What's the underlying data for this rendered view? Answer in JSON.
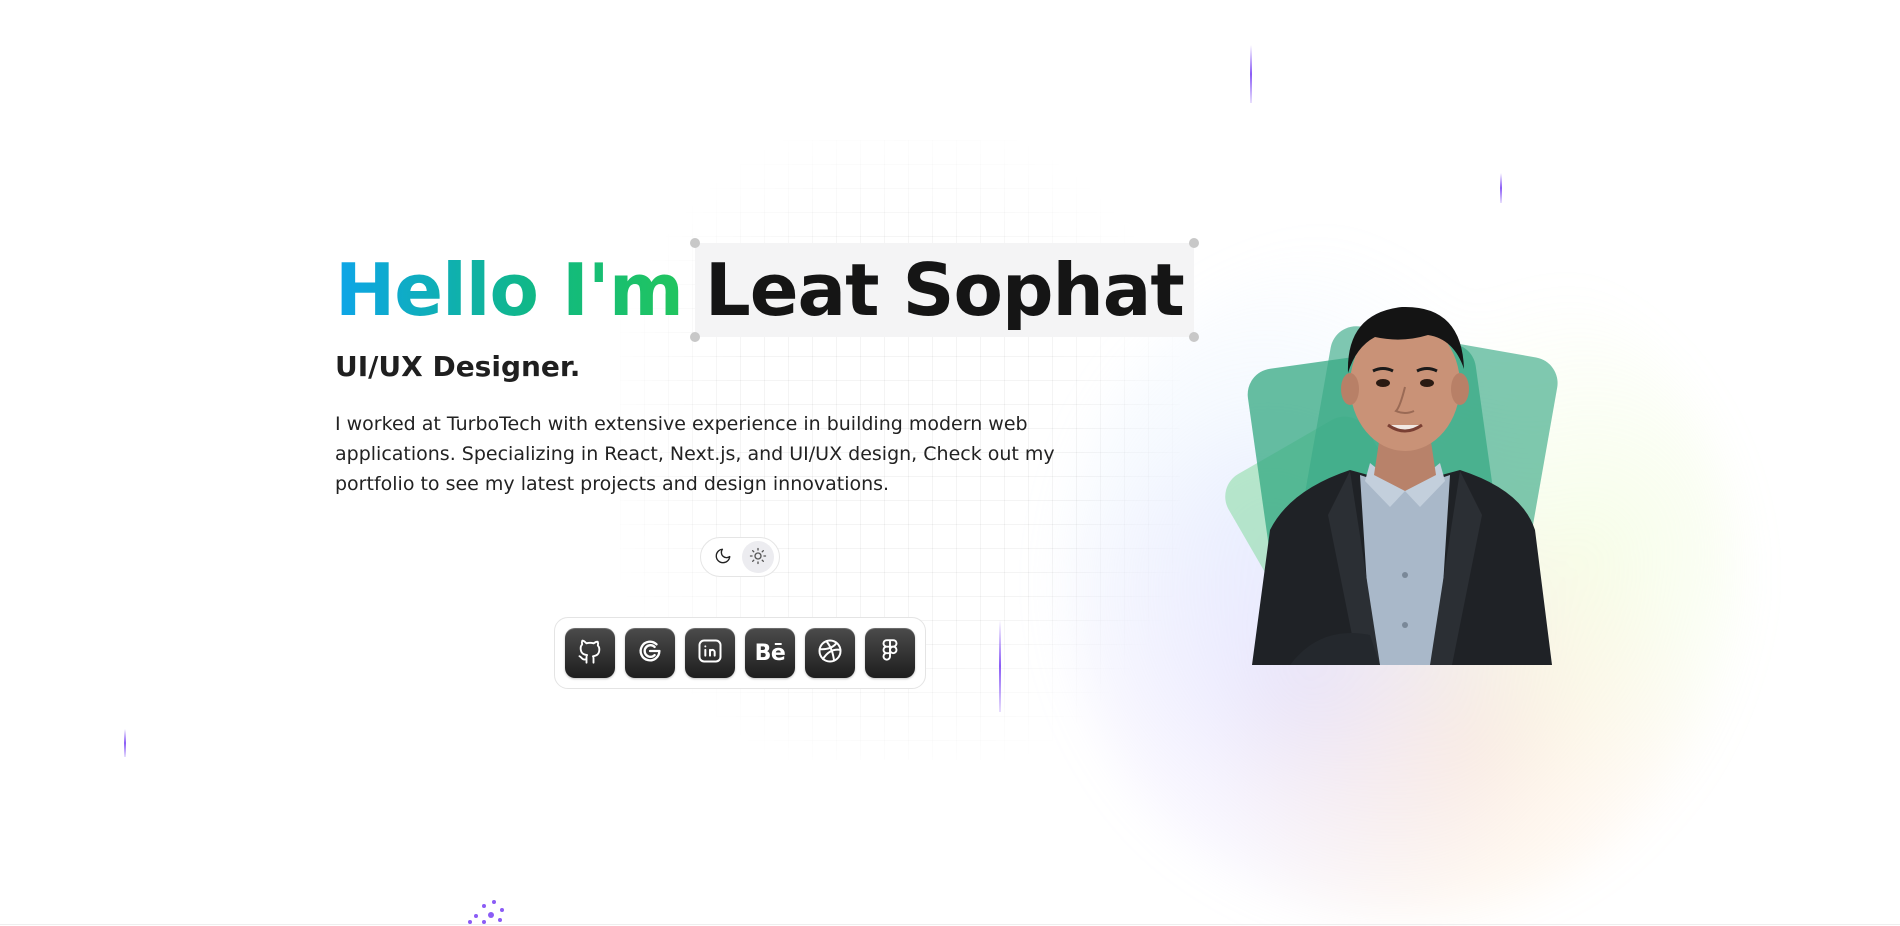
{
  "hero": {
    "greeting": "Hello I'm",
    "name": "Leat Sophat",
    "role": "UI/UX Designer.",
    "bio": "I worked at TurboTech with extensive experience in building modern web applications. Specializing in React, Next.js, and UI/UX design, Check out my portfolio to see my latest projects and design innovations."
  },
  "theme_toggle": {
    "options": [
      {
        "icon": "moon-icon",
        "active": false
      },
      {
        "icon": "sun-icon",
        "active": true
      }
    ]
  },
  "social_links": [
    {
      "icon": "github-icon"
    },
    {
      "icon": "google-icon"
    },
    {
      "icon": "linkedin-icon"
    },
    {
      "icon": "behance-icon",
      "label": "Bē"
    },
    {
      "icon": "dribbble-icon"
    },
    {
      "icon": "figma-icon"
    }
  ],
  "colors": {
    "gradient_start": "#0ea5e9",
    "gradient_end": "#22c55e",
    "accent_purple": "#8b5cf6",
    "card_green": "#34a881"
  }
}
